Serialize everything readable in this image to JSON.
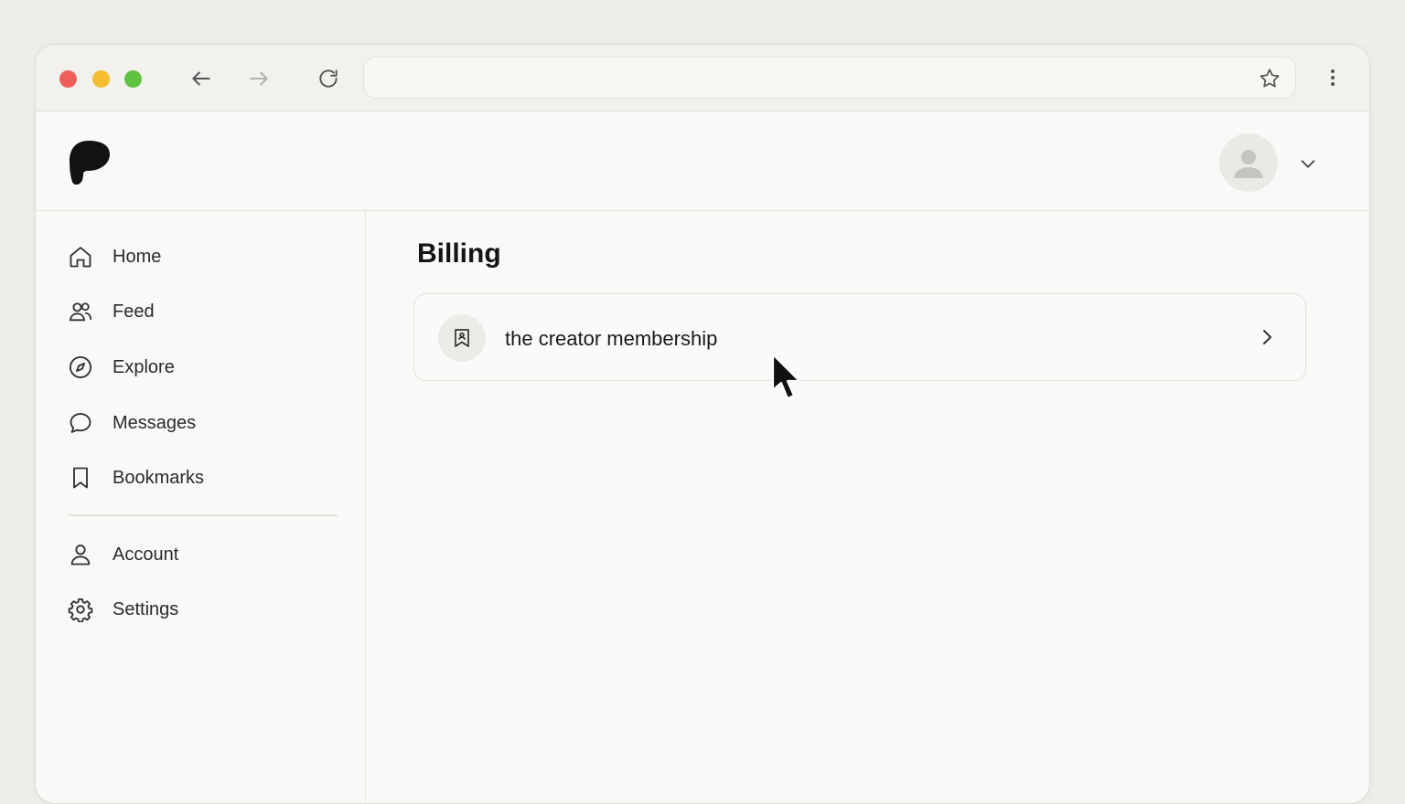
{
  "browser": {
    "url_value": "",
    "url_placeholder": ""
  },
  "sidebar": {
    "items": [
      {
        "label": "Home",
        "icon": "home-icon"
      },
      {
        "label": "Feed",
        "icon": "users-icon"
      },
      {
        "label": "Explore",
        "icon": "compass-icon"
      },
      {
        "label": "Messages",
        "icon": "message-icon"
      },
      {
        "label": "Bookmarks",
        "icon": "bookmark-icon"
      },
      {
        "label": "Account",
        "icon": "user-icon"
      },
      {
        "label": "Settings",
        "icon": "gear-icon"
      }
    ]
  },
  "main": {
    "title": "Billing",
    "membership": {
      "label": "the creator membership",
      "icon": "membership-badge-icon"
    }
  },
  "colors": {
    "page_background": "#efede7",
    "window_background": "#faf9f7",
    "traffic_red": "#ee5f57",
    "traffic_yellow": "#f4bd2f",
    "traffic_green": "#5fc342"
  }
}
